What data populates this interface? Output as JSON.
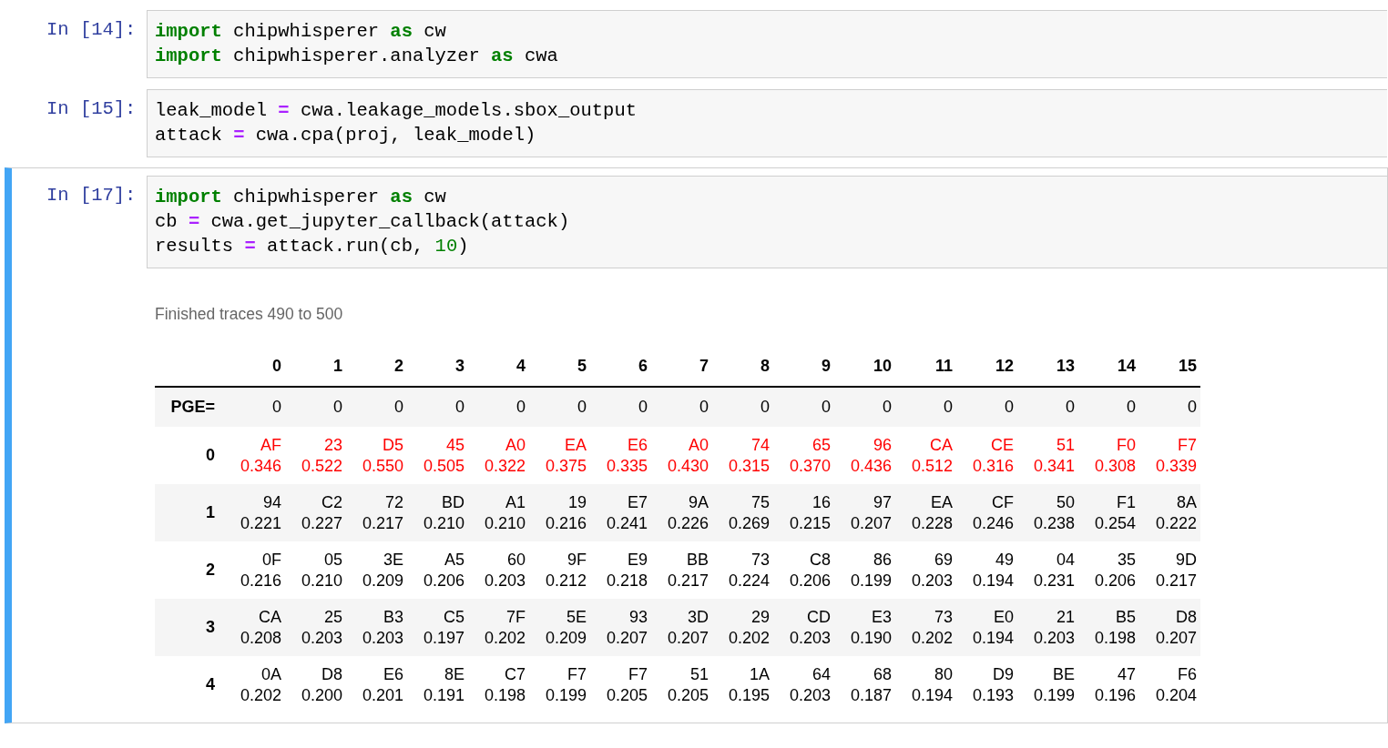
{
  "cells": [
    {
      "prompt": "In [14]:",
      "selected": false,
      "lines": [
        [
          {
            "kind": "kw",
            "text": "import"
          },
          {
            "kind": "text",
            "text": " chipwhisperer "
          },
          {
            "kind": "kw",
            "text": "as"
          },
          {
            "kind": "text",
            "text": " cw"
          }
        ],
        [
          {
            "kind": "kw",
            "text": "import"
          },
          {
            "kind": "text",
            "text": " chipwhisperer.analyzer "
          },
          {
            "kind": "kw",
            "text": "as"
          },
          {
            "kind": "text",
            "text": " cwa"
          }
        ]
      ]
    },
    {
      "prompt": "In [15]:",
      "selected": false,
      "lines": [
        [
          {
            "kind": "text",
            "text": "leak_model "
          },
          {
            "kind": "op",
            "text": "="
          },
          {
            "kind": "text",
            "text": " cwa.leakage_models.sbox_output"
          }
        ],
        [
          {
            "kind": "text",
            "text": "attack "
          },
          {
            "kind": "op",
            "text": "="
          },
          {
            "kind": "text",
            "text": " cwa.cpa(proj, leak_model)"
          }
        ]
      ]
    },
    {
      "prompt": "In [17]:",
      "selected": true,
      "lines": [
        [
          {
            "kind": "kw",
            "text": "import"
          },
          {
            "kind": "text",
            "text": " chipwhisperer "
          },
          {
            "kind": "kw",
            "text": "as"
          },
          {
            "kind": "text",
            "text": " cw"
          }
        ],
        [
          {
            "kind": "text",
            "text": "cb "
          },
          {
            "kind": "op",
            "text": "="
          },
          {
            "kind": "text",
            "text": " cwa.get_jupyter_callback(attack)"
          }
        ],
        [
          {
            "kind": "text",
            "text": "results "
          },
          {
            "kind": "op",
            "text": "="
          },
          {
            "kind": "text",
            "text": " attack.run(cb, "
          },
          {
            "kind": "num",
            "text": "10"
          },
          {
            "kind": "text",
            "text": ")"
          }
        ]
      ],
      "output": {
        "status": "Finished traces 490 to 500",
        "table": {
          "columns": [
            "0",
            "1",
            "2",
            "3",
            "4",
            "5",
            "6",
            "7",
            "8",
            "9",
            "10",
            "11",
            "12",
            "13",
            "14",
            "15"
          ],
          "pge": {
            "label": "PGE=",
            "values": [
              "0",
              "0",
              "0",
              "0",
              "0",
              "0",
              "0",
              "0",
              "0",
              "0",
              "0",
              "0",
              "0",
              "0",
              "0",
              "0"
            ]
          },
          "rows": [
            {
              "label": "0",
              "correct": true,
              "cells": [
                [
                  "AF",
                  "0.346"
                ],
                [
                  "23",
                  "0.522"
                ],
                [
                  "D5",
                  "0.550"
                ],
                [
                  "45",
                  "0.505"
                ],
                [
                  "A0",
                  "0.322"
                ],
                [
                  "EA",
                  "0.375"
                ],
                [
                  "E6",
                  "0.335"
                ],
                [
                  "A0",
                  "0.430"
                ],
                [
                  "74",
                  "0.315"
                ],
                [
                  "65",
                  "0.370"
                ],
                [
                  "96",
                  "0.436"
                ],
                [
                  "CA",
                  "0.512"
                ],
                [
                  "CE",
                  "0.316"
                ],
                [
                  "51",
                  "0.341"
                ],
                [
                  "F0",
                  "0.308"
                ],
                [
                  "F7",
                  "0.339"
                ]
              ]
            },
            {
              "label": "1",
              "correct": false,
              "cells": [
                [
                  "94",
                  "0.221"
                ],
                [
                  "C2",
                  "0.227"
                ],
                [
                  "72",
                  "0.217"
                ],
                [
                  "BD",
                  "0.210"
                ],
                [
                  "A1",
                  "0.210"
                ],
                [
                  "19",
                  "0.216"
                ],
                [
                  "E7",
                  "0.241"
                ],
                [
                  "9A",
                  "0.226"
                ],
                [
                  "75",
                  "0.269"
                ],
                [
                  "16",
                  "0.215"
                ],
                [
                  "97",
                  "0.207"
                ],
                [
                  "EA",
                  "0.228"
                ],
                [
                  "CF",
                  "0.246"
                ],
                [
                  "50",
                  "0.238"
                ],
                [
                  "F1",
                  "0.254"
                ],
                [
                  "8A",
                  "0.222"
                ]
              ]
            },
            {
              "label": "2",
              "correct": false,
              "cells": [
                [
                  "0F",
                  "0.216"
                ],
                [
                  "05",
                  "0.210"
                ],
                [
                  "3E",
                  "0.209"
                ],
                [
                  "A5",
                  "0.206"
                ],
                [
                  "60",
                  "0.203"
                ],
                [
                  "9F",
                  "0.212"
                ],
                [
                  "E9",
                  "0.218"
                ],
                [
                  "BB",
                  "0.217"
                ],
                [
                  "73",
                  "0.224"
                ],
                [
                  "C8",
                  "0.206"
                ],
                [
                  "86",
                  "0.199"
                ],
                [
                  "69",
                  "0.203"
                ],
                [
                  "49",
                  "0.194"
                ],
                [
                  "04",
                  "0.231"
                ],
                [
                  "35",
                  "0.206"
                ],
                [
                  "9D",
                  "0.217"
                ]
              ]
            },
            {
              "label": "3",
              "correct": false,
              "cells": [
                [
                  "CA",
                  "0.208"
                ],
                [
                  "25",
                  "0.203"
                ],
                [
                  "B3",
                  "0.203"
                ],
                [
                  "C5",
                  "0.197"
                ],
                [
                  "7F",
                  "0.202"
                ],
                [
                  "5E",
                  "0.209"
                ],
                [
                  "93",
                  "0.207"
                ],
                [
                  "3D",
                  "0.207"
                ],
                [
                  "29",
                  "0.202"
                ],
                [
                  "CD",
                  "0.203"
                ],
                [
                  "E3",
                  "0.190"
                ],
                [
                  "73",
                  "0.202"
                ],
                [
                  "E0",
                  "0.194"
                ],
                [
                  "21",
                  "0.203"
                ],
                [
                  "B5",
                  "0.198"
                ],
                [
                  "D8",
                  "0.207"
                ]
              ]
            },
            {
              "label": "4",
              "correct": false,
              "cells": [
                [
                  "0A",
                  "0.202"
                ],
                [
                  "D8",
                  "0.200"
                ],
                [
                  "E6",
                  "0.201"
                ],
                [
                  "8E",
                  "0.191"
                ],
                [
                  "C7",
                  "0.198"
                ],
                [
                  "F7",
                  "0.199"
                ],
                [
                  "F7",
                  "0.205"
                ],
                [
                  "51",
                  "0.205"
                ],
                [
                  "1A",
                  "0.195"
                ],
                [
                  "64",
                  "0.203"
                ],
                [
                  "68",
                  "0.187"
                ],
                [
                  "80",
                  "0.194"
                ],
                [
                  "D9",
                  "0.193"
                ],
                [
                  "BE",
                  "0.199"
                ],
                [
                  "47",
                  "0.196"
                ],
                [
                  "F6",
                  "0.204"
                ]
              ]
            }
          ]
        }
      }
    }
  ]
}
